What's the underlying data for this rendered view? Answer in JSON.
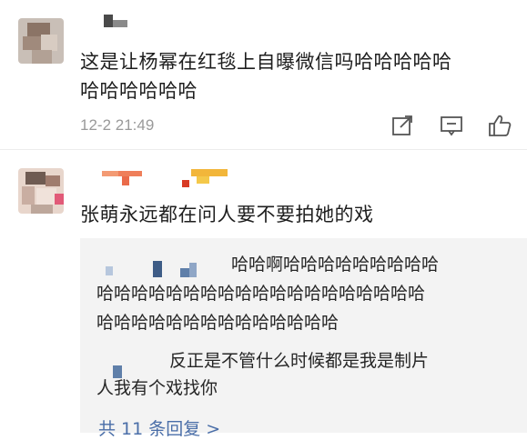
{
  "comments": [
    {
      "text_line1": "这是让杨幂在红毯上自曝微信吗哈哈哈哈哈",
      "text_line2": "哈哈哈哈哈哈",
      "time": "12-2 21:49",
      "icons": [
        "share-icon",
        "comment-icon",
        "like-icon"
      ]
    },
    {
      "text": "张萌永远都在问人要不要拍她的戏",
      "replies": [
        {
          "line1": "哈哈啊哈哈哈哈哈哈哈哈哈",
          "line2": "哈哈哈哈哈哈哈哈哈哈哈哈哈哈哈哈哈哈哈",
          "line3": "哈哈哈哈哈哈哈哈哈哈哈哈哈哈"
        },
        {
          "line1": "反正是不管什么时候都是我是制片",
          "line2": "人我有个戏找你"
        }
      ],
      "more_replies": "共 11 条回复 >"
    }
  ],
  "colors": {
    "link": "#4a6ea8",
    "meta": "#9a9a9a",
    "reply_bg": "#f3f3f3"
  }
}
